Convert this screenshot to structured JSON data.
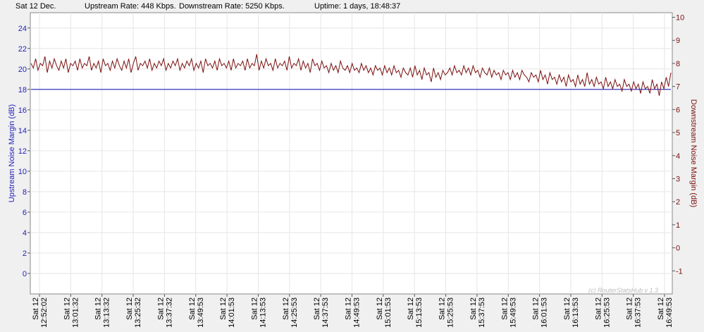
{
  "status": {
    "date": "Sat 12 Dec.",
    "upstream": "Upstream Rate: 448 Kbps.",
    "downstream": "Downstream Rate: 5250 Kbps.",
    "uptime": "Uptime: 1 days, 18:48:37"
  },
  "chart_data": {
    "type": "line",
    "ylabel": "Upstream Noise Margin (dB)",
    "y2label": "Downstream Noise Margin (dB)",
    "ylim": [
      -2,
      25.5
    ],
    "y2lim": [
      -2,
      10.2
    ],
    "yticks": [
      0,
      2,
      4,
      6,
      8,
      10,
      12,
      14,
      16,
      18,
      20,
      22,
      24
    ],
    "y2ticks": [
      -1,
      0,
      1,
      2,
      3,
      4,
      5,
      6,
      7,
      8,
      9,
      10
    ],
    "xticks": [
      {
        "day": "Sat 12",
        "time": "12:52:02"
      },
      {
        "day": "Sat 12",
        "time": "13:01:32"
      },
      {
        "day": "Sat 12",
        "time": "13:13:32"
      },
      {
        "day": "Sat 12",
        "time": "13:25:32"
      },
      {
        "day": "Sat 12",
        "time": "13:37:32"
      },
      {
        "day": "Sat 12",
        "time": "13:49:53"
      },
      {
        "day": "Sat 12",
        "time": "14:01:53"
      },
      {
        "day": "Sat 12",
        "time": "14:13:53"
      },
      {
        "day": "Sat 12",
        "time": "14:25:53"
      },
      {
        "day": "Sat 12",
        "time": "14:37:53"
      },
      {
        "day": "Sat 12",
        "time": "14:49:53"
      },
      {
        "day": "Sat 12",
        "time": "15:01:53"
      },
      {
        "day": "Sat 12",
        "time": "15:13:53"
      },
      {
        "day": "Sat 12",
        "time": "15:25:53"
      },
      {
        "day": "Sat 12",
        "time": "15:37:53"
      },
      {
        "day": "Sat 12",
        "time": "15:49:53"
      },
      {
        "day": "Sat 12",
        "time": "16:01:53"
      },
      {
        "day": "Sat 12",
        "time": "16:13:53"
      },
      {
        "day": "Sat 12",
        "time": "16:25:53"
      },
      {
        "day": "Sat 12",
        "time": "16:37:53"
      },
      {
        "day": "Sat 12",
        "time": "16:49:53"
      }
    ],
    "series": [
      {
        "axis": "left",
        "color": "#2222bb",
        "values": [
          18,
          18
        ]
      },
      {
        "axis": "right",
        "color": "#7a1010",
        "values": [
          8.0,
          7.8,
          8.2,
          7.7,
          8.0,
          7.9,
          8.3,
          7.6,
          8.1,
          7.8,
          8.2,
          7.9,
          7.7,
          8.1,
          7.8,
          8.2,
          7.6,
          8.0,
          7.9,
          8.1,
          7.7,
          8.2,
          7.8,
          8.0,
          7.9,
          8.3,
          7.7,
          8.0,
          7.8,
          8.1,
          7.6,
          8.2,
          7.9,
          8.0,
          7.7,
          8.1,
          7.8,
          8.2,
          7.9,
          7.7,
          8.1,
          7.8,
          8.2,
          7.6,
          8.0,
          8.3,
          7.7,
          8.0,
          7.9,
          8.1,
          7.8,
          8.2,
          7.7,
          8.0,
          7.8,
          8.1,
          7.9,
          8.2,
          7.7,
          8.0,
          7.8,
          8.1,
          7.9,
          8.2,
          7.7,
          8.0,
          7.8,
          8.1,
          7.9,
          8.2,
          7.7,
          8.0,
          7.8,
          8.1,
          7.6,
          8.2,
          7.9,
          8.0,
          7.8,
          8.1,
          7.7,
          8.2,
          7.9,
          8.0,
          7.8,
          8.1,
          7.7,
          8.2,
          7.8,
          8.0,
          7.9,
          8.1,
          7.7,
          8.2,
          7.8,
          8.0,
          7.9,
          8.4,
          7.7,
          8.1,
          7.8,
          8.2,
          7.9,
          8.0,
          7.7,
          8.2,
          7.8,
          8.0,
          7.9,
          8.1,
          7.7,
          8.3,
          7.8,
          8.0,
          7.9,
          8.2,
          7.7,
          8.1,
          7.8,
          8.0,
          7.6,
          8.2,
          7.9,
          8.0,
          7.7,
          8.1,
          7.8,
          7.9,
          7.6,
          8.0,
          7.7,
          7.9,
          7.6,
          8.1,
          7.8,
          7.7,
          7.9,
          7.6,
          8.0,
          7.7,
          7.8,
          7.6,
          8.0,
          7.7,
          7.9,
          7.6,
          7.8,
          7.5,
          7.9,
          7.7,
          7.8,
          7.5,
          7.9,
          7.6,
          7.8,
          7.5,
          7.9,
          7.6,
          7.7,
          7.4,
          7.8,
          7.6,
          7.5,
          7.8,
          7.4,
          7.9,
          7.5,
          7.7,
          7.3,
          7.8,
          7.5,
          7.6,
          7.2,
          7.8,
          7.4,
          7.6,
          7.3,
          7.7,
          7.5,
          7.6,
          7.8,
          7.5,
          7.9,
          7.6,
          7.7,
          7.5,
          7.9,
          7.6,
          7.8,
          7.5,
          7.9,
          7.6,
          7.7,
          7.4,
          7.8,
          7.6,
          7.5,
          7.8,
          7.4,
          7.7,
          7.5,
          7.6,
          7.3,
          7.7,
          7.5,
          7.6,
          7.3,
          7.7,
          7.4,
          7.6,
          7.3,
          7.7,
          7.5,
          7.4,
          7.2,
          7.6,
          7.4,
          7.5,
          7.2,
          7.7,
          7.3,
          7.5,
          7.1,
          7.6,
          7.3,
          7.4,
          7.1,
          7.5,
          7.2,
          7.4,
          7.0,
          7.5,
          7.2,
          7.3,
          7.0,
          7.5,
          7.1,
          7.3,
          7.0,
          7.6,
          7.1,
          7.3,
          7.0,
          7.4,
          7.1,
          7.2,
          6.9,
          7.4,
          7.0,
          7.2,
          6.9,
          7.3,
          7.0,
          7.1,
          6.8,
          7.3,
          7.0,
          7.1,
          6.8,
          7.2,
          6.9,
          7.1,
          6.7,
          7.2,
          6.9,
          7.0,
          6.7,
          7.3,
          6.9,
          7.1,
          6.6,
          7.2,
          6.9,
          7.4,
          7.0,
          7.6
        ]
      }
    ],
    "watermark": "(c) RouterStatsHub v 1.3"
  }
}
